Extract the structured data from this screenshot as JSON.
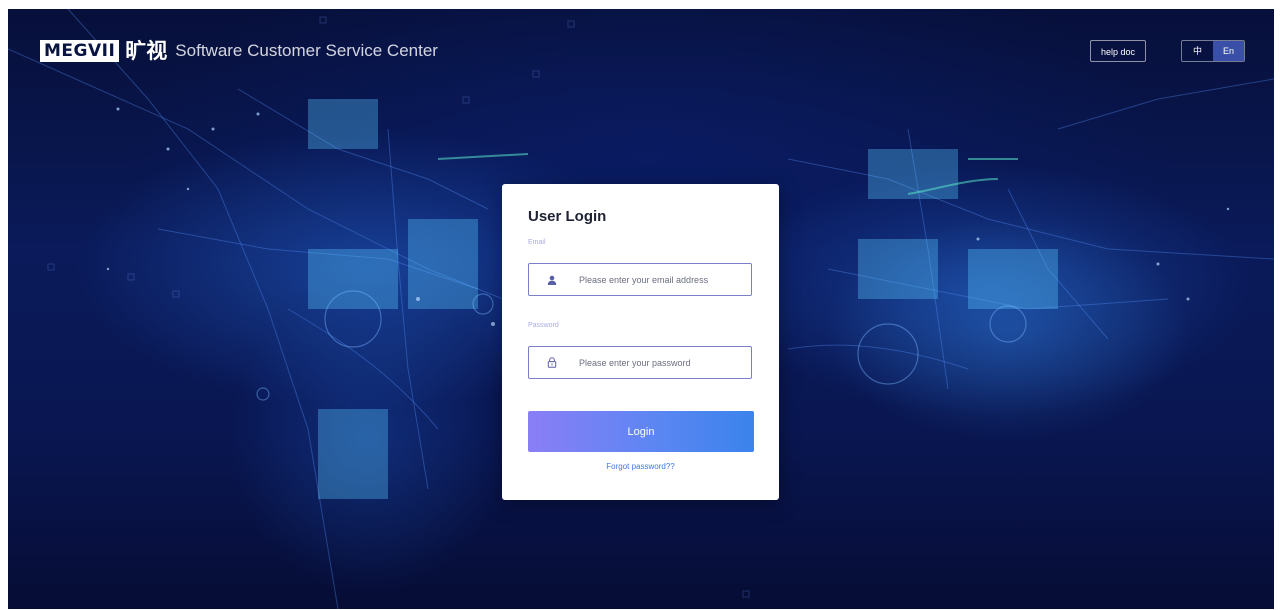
{
  "header": {
    "logo_wordmark": "MEGVII",
    "logo_chinese": "旷视",
    "site_title": "Software Customer Service Center",
    "help_label": "help doc",
    "lang_options": [
      {
        "label": "中",
        "selected": false
      },
      {
        "label": "En",
        "selected": true
      }
    ]
  },
  "login": {
    "title": "User Login",
    "email_label": "Email",
    "email_placeholder": "Please enter your email address",
    "email_value": "",
    "password_label": "Password",
    "password_placeholder": "Please enter your password",
    "password_value": "",
    "submit_label": "Login",
    "forgot_label": "Forgot password??"
  },
  "icons": {
    "email": "user-icon",
    "password": "lock-icon"
  },
  "colors": {
    "background": "#0a1a5a",
    "field_label": "#a7abe4",
    "input_border": "#7a7fc8",
    "button_start": "#8a7ef5",
    "button_end": "#3b83ec",
    "link": "#3f79e6",
    "lang_active": "#3a4fa8"
  }
}
